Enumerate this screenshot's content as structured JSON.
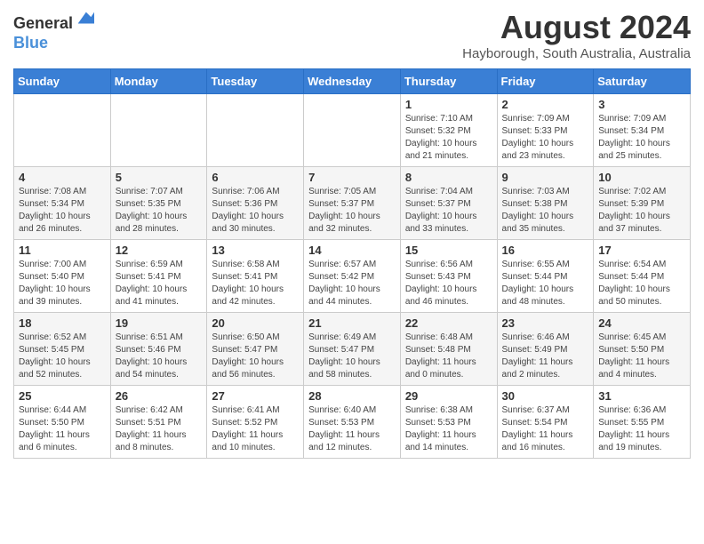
{
  "header": {
    "logo_line1": "General",
    "logo_line2": "Blue",
    "month": "August 2024",
    "location": "Hayborough, South Australia, Australia"
  },
  "days_of_week": [
    "Sunday",
    "Monday",
    "Tuesday",
    "Wednesday",
    "Thursday",
    "Friday",
    "Saturday"
  ],
  "weeks": [
    [
      {
        "day": "",
        "info": ""
      },
      {
        "day": "",
        "info": ""
      },
      {
        "day": "",
        "info": ""
      },
      {
        "day": "",
        "info": ""
      },
      {
        "day": "1",
        "info": "Sunrise: 7:10 AM\nSunset: 5:32 PM\nDaylight: 10 hours\nand 21 minutes."
      },
      {
        "day": "2",
        "info": "Sunrise: 7:09 AM\nSunset: 5:33 PM\nDaylight: 10 hours\nand 23 minutes."
      },
      {
        "day": "3",
        "info": "Sunrise: 7:09 AM\nSunset: 5:34 PM\nDaylight: 10 hours\nand 25 minutes."
      }
    ],
    [
      {
        "day": "4",
        "info": "Sunrise: 7:08 AM\nSunset: 5:34 PM\nDaylight: 10 hours\nand 26 minutes."
      },
      {
        "day": "5",
        "info": "Sunrise: 7:07 AM\nSunset: 5:35 PM\nDaylight: 10 hours\nand 28 minutes."
      },
      {
        "day": "6",
        "info": "Sunrise: 7:06 AM\nSunset: 5:36 PM\nDaylight: 10 hours\nand 30 minutes."
      },
      {
        "day": "7",
        "info": "Sunrise: 7:05 AM\nSunset: 5:37 PM\nDaylight: 10 hours\nand 32 minutes."
      },
      {
        "day": "8",
        "info": "Sunrise: 7:04 AM\nSunset: 5:37 PM\nDaylight: 10 hours\nand 33 minutes."
      },
      {
        "day": "9",
        "info": "Sunrise: 7:03 AM\nSunset: 5:38 PM\nDaylight: 10 hours\nand 35 minutes."
      },
      {
        "day": "10",
        "info": "Sunrise: 7:02 AM\nSunset: 5:39 PM\nDaylight: 10 hours\nand 37 minutes."
      }
    ],
    [
      {
        "day": "11",
        "info": "Sunrise: 7:00 AM\nSunset: 5:40 PM\nDaylight: 10 hours\nand 39 minutes."
      },
      {
        "day": "12",
        "info": "Sunrise: 6:59 AM\nSunset: 5:41 PM\nDaylight: 10 hours\nand 41 minutes."
      },
      {
        "day": "13",
        "info": "Sunrise: 6:58 AM\nSunset: 5:41 PM\nDaylight: 10 hours\nand 42 minutes."
      },
      {
        "day": "14",
        "info": "Sunrise: 6:57 AM\nSunset: 5:42 PM\nDaylight: 10 hours\nand 44 minutes."
      },
      {
        "day": "15",
        "info": "Sunrise: 6:56 AM\nSunset: 5:43 PM\nDaylight: 10 hours\nand 46 minutes."
      },
      {
        "day": "16",
        "info": "Sunrise: 6:55 AM\nSunset: 5:44 PM\nDaylight: 10 hours\nand 48 minutes."
      },
      {
        "day": "17",
        "info": "Sunrise: 6:54 AM\nSunset: 5:44 PM\nDaylight: 10 hours\nand 50 minutes."
      }
    ],
    [
      {
        "day": "18",
        "info": "Sunrise: 6:52 AM\nSunset: 5:45 PM\nDaylight: 10 hours\nand 52 minutes."
      },
      {
        "day": "19",
        "info": "Sunrise: 6:51 AM\nSunset: 5:46 PM\nDaylight: 10 hours\nand 54 minutes."
      },
      {
        "day": "20",
        "info": "Sunrise: 6:50 AM\nSunset: 5:47 PM\nDaylight: 10 hours\nand 56 minutes."
      },
      {
        "day": "21",
        "info": "Sunrise: 6:49 AM\nSunset: 5:47 PM\nDaylight: 10 hours\nand 58 minutes."
      },
      {
        "day": "22",
        "info": "Sunrise: 6:48 AM\nSunset: 5:48 PM\nDaylight: 11 hours\nand 0 minutes."
      },
      {
        "day": "23",
        "info": "Sunrise: 6:46 AM\nSunset: 5:49 PM\nDaylight: 11 hours\nand 2 minutes."
      },
      {
        "day": "24",
        "info": "Sunrise: 6:45 AM\nSunset: 5:50 PM\nDaylight: 11 hours\nand 4 minutes."
      }
    ],
    [
      {
        "day": "25",
        "info": "Sunrise: 6:44 AM\nSunset: 5:50 PM\nDaylight: 11 hours\nand 6 minutes."
      },
      {
        "day": "26",
        "info": "Sunrise: 6:42 AM\nSunset: 5:51 PM\nDaylight: 11 hours\nand 8 minutes."
      },
      {
        "day": "27",
        "info": "Sunrise: 6:41 AM\nSunset: 5:52 PM\nDaylight: 11 hours\nand 10 minutes."
      },
      {
        "day": "28",
        "info": "Sunrise: 6:40 AM\nSunset: 5:53 PM\nDaylight: 11 hours\nand 12 minutes."
      },
      {
        "day": "29",
        "info": "Sunrise: 6:38 AM\nSunset: 5:53 PM\nDaylight: 11 hours\nand 14 minutes."
      },
      {
        "day": "30",
        "info": "Sunrise: 6:37 AM\nSunset: 5:54 PM\nDaylight: 11 hours\nand 16 minutes."
      },
      {
        "day": "31",
        "info": "Sunrise: 6:36 AM\nSunset: 5:55 PM\nDaylight: 11 hours\nand 19 minutes."
      }
    ]
  ]
}
